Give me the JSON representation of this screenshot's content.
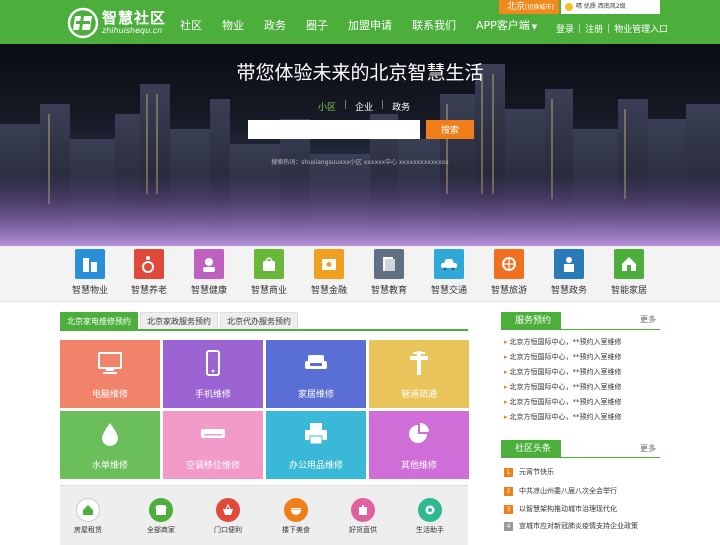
{
  "header": {
    "logo": {
      "title": "智慧社区",
      "subtitle": "zhihuishequ.cn"
    },
    "nav": [
      "社区",
      "物业",
      "政务",
      "圈子",
      "加盟申请",
      "联系我们",
      "APP客户端"
    ],
    "city": {
      "name": "北京",
      "note": "[切换城市]"
    },
    "weather": "晴 优质 西南风2级",
    "login": "登录",
    "register": "注册",
    "property_entry": "物业管理入口"
  },
  "hero": {
    "title": "带您体验未来的北京智慧生活",
    "tabs": [
      "小区",
      "企业",
      "政务"
    ],
    "active_tab": 0,
    "search_placeholder": "",
    "search_button": "搜索",
    "hot_text": "搜索热词：shuxiangsuuxxx小区 xxxxxx中心 xxxxxxxxxxxxxx"
  },
  "services": [
    {
      "label": "智慧物业",
      "color": "#2a8fd8",
      "icon": "building-icon"
    },
    {
      "label": "智慧养老",
      "color": "#e04a3a",
      "icon": "wheelchair-icon"
    },
    {
      "label": "智慧健康",
      "color": "#c060c0",
      "icon": "nurse-icon"
    },
    {
      "label": "智慧商业",
      "color": "#6ab83a",
      "icon": "shopping-icon"
    },
    {
      "label": "智慧金融",
      "color": "#f0a020",
      "icon": "finance-icon"
    },
    {
      "label": "智慧教育",
      "color": "#607080",
      "icon": "education-icon"
    },
    {
      "label": "智慧交通",
      "color": "#30a8d8",
      "icon": "car-icon"
    },
    {
      "label": "智慧旅游",
      "color": "#f07020",
      "icon": "travel-icon"
    },
    {
      "label": "智慧政务",
      "color": "#2a7ab8",
      "icon": "government-icon"
    },
    {
      "label": "智能家居",
      "color": "#4caf3c",
      "icon": "smart-home-icon"
    }
  ],
  "service_tabs": [
    "北京家电维修预约",
    "北京家政服务预约",
    "北京代办服务预约"
  ],
  "tiles": [
    {
      "label": "电脑维修",
      "color": "#f2836b",
      "icon": "computer-icon"
    },
    {
      "label": "手机维修",
      "color": "#9b64d2",
      "icon": "phone-icon"
    },
    {
      "label": "家居维修",
      "color": "#5a6fd6",
      "icon": "sofa-icon"
    },
    {
      "label": "管道疏通",
      "color": "#e8c45a",
      "icon": "plumbing-icon"
    },
    {
      "label": "水单维修",
      "color": "#6abf5a",
      "icon": "water-drop-icon"
    },
    {
      "label": "空调移位维修",
      "color": "#f29ac8",
      "icon": "air-conditioner-icon"
    },
    {
      "label": "办公用品维修",
      "color": "#3ab8d8",
      "icon": "printer-icon"
    },
    {
      "label": "其他维修",
      "color": "#d06ed8",
      "icon": "pie-chart-icon"
    }
  ],
  "bottom_icons": [
    {
      "label": "房屋租赁",
      "color": "#ffffff",
      "icon": "house-icon"
    },
    {
      "label": "全部商家",
      "color": "#4caf3c",
      "icon": "store-icon"
    },
    {
      "label": "门口便利",
      "color": "#e04a3a",
      "icon": "basket-icon"
    },
    {
      "label": "楼下美食",
      "color": "#f07e1a",
      "icon": "food-icon"
    },
    {
      "label": "好货直供",
      "color": "#e060a0",
      "icon": "goods-icon"
    },
    {
      "label": "生活助手",
      "color": "#30b890",
      "icon": "assistant-icon"
    }
  ],
  "booking": {
    "title": "服务预约",
    "more": "更多",
    "items": [
      "北京方恒国际中心，**预约入室维修",
      "北京方恒国际中心，**预约入室维修",
      "北京方恒国际中心，**预约入室维修",
      "北京方恒国际中心，**预约入室维修",
      "北京方恒国际中心，**预约入室维修",
      "北京方恒国际中心，**预约入室维修"
    ]
  },
  "news": {
    "title": "社区头条",
    "more": "更多",
    "items": [
      {
        "num": "1",
        "text": "元宵节快乐",
        "color": "#f07e1a"
      },
      {
        "num": "2",
        "text": "中共凉山州委八届八次全会举行",
        "color": "#f07e1a"
      },
      {
        "num": "3",
        "text": "以智慧架构推动城市治理现代化",
        "color": "#f07e1a"
      },
      {
        "num": "4",
        "text": "宣城市应对新冠肺炎疫情支持企业政策",
        "color": "#999999"
      }
    ]
  }
}
